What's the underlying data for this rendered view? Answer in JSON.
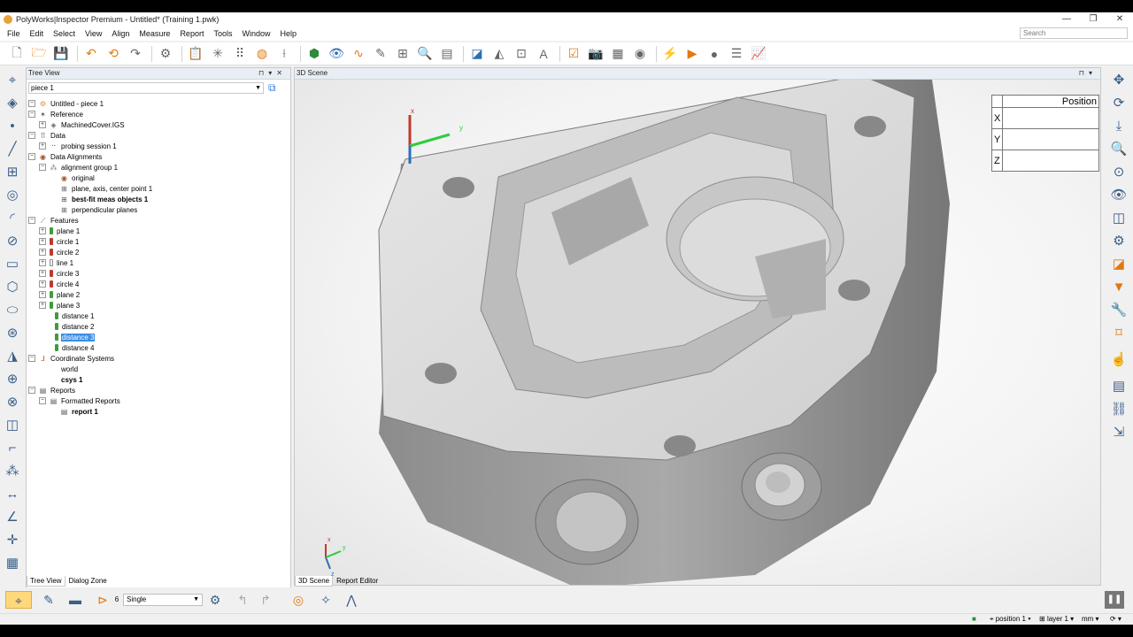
{
  "window": {
    "title": "PolyWorks|Inspector Premium - Untitled* (Training 1.pwk)",
    "min": "—",
    "max": "❐",
    "close": "✕"
  },
  "menu": [
    "File",
    "Edit",
    "Select",
    "View",
    "Align",
    "Measure",
    "Report",
    "Tools",
    "Window",
    "Help"
  ],
  "search": {
    "placeholder": "Search"
  },
  "tree_view": {
    "title": "Tree View",
    "combo_value": "piece 1",
    "rows": [
      {
        "label": "Untitled - piece 1"
      },
      {
        "label": "Reference"
      },
      {
        "label": "MachinedCover.IGS"
      },
      {
        "label": "Data"
      },
      {
        "label": "probing session 1"
      },
      {
        "label": "Data Alignments"
      },
      {
        "label": "alignment group 1"
      },
      {
        "label": "original"
      },
      {
        "label": "plane, axis, center point 1"
      },
      {
        "label": "best-fit meas objects 1"
      },
      {
        "label": "perpendicular planes"
      },
      {
        "label": "Features"
      },
      {
        "label": "plane 1"
      },
      {
        "label": "circle 1"
      },
      {
        "label": "circle 2"
      },
      {
        "label": "line 1"
      },
      {
        "label": "circle 3"
      },
      {
        "label": "circle 4"
      },
      {
        "label": "plane 2"
      },
      {
        "label": "plane 3"
      },
      {
        "label": "distance 1"
      },
      {
        "label": "distance 2"
      },
      {
        "label": "distance 3"
      },
      {
        "label": "distance 4"
      },
      {
        "label": "Coordinate Systems"
      },
      {
        "label": "world"
      },
      {
        "label": "csys 1"
      },
      {
        "label": "Reports"
      },
      {
        "label": "Formatted Reports"
      },
      {
        "label": "report 1"
      }
    ],
    "feature_colors": {
      "plane": "#3f9c3a",
      "circle": "#c0392b",
      "distance": "#3f9c3a"
    },
    "selected_color": "#3a8ee6"
  },
  "left_tabs": [
    "Tree View",
    "Dialog Zone"
  ],
  "scene": {
    "title": "3D Scene",
    "axis_labels": {
      "x": "x",
      "y": "y",
      "z": "z"
    },
    "position_table": {
      "header": "Position",
      "rows": [
        "X",
        "Y",
        "Z"
      ]
    }
  },
  "scene_tabs": [
    "3D Scene",
    "Report Editor"
  ],
  "bottom": {
    "count": "6",
    "mode": "Single"
  },
  "status": {
    "position": "position 1",
    "layer": "layer 1",
    "units": "mm"
  }
}
